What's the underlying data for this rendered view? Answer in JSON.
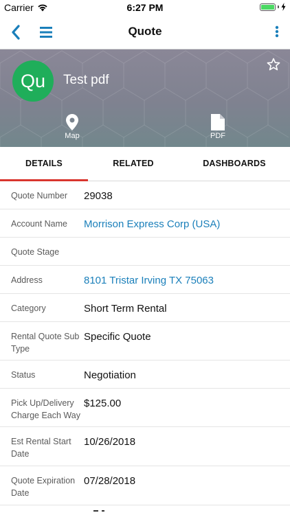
{
  "status_bar": {
    "carrier": "Carrier",
    "time": "6:27 PM"
  },
  "nav": {
    "title": "Quote",
    "accent_color": "#1a7fba"
  },
  "header": {
    "avatar_initials": "Qu",
    "avatar_color": "#1fae5a",
    "record_name": "Test pdf",
    "actions": [
      {
        "label": "Map",
        "icon": "map-pin-icon"
      },
      {
        "label": "PDF",
        "icon": "document-icon"
      }
    ]
  },
  "tabs": {
    "items": [
      {
        "label": "DETAILS",
        "active": true
      },
      {
        "label": "RELATED",
        "active": false
      },
      {
        "label": "DASHBOARDS",
        "active": false
      }
    ],
    "active_color": "#d9352d"
  },
  "fields": [
    {
      "label": "Quote Number",
      "value": "29038",
      "link": false
    },
    {
      "label": "Account Name",
      "value": "Morrison Express Corp (USA)",
      "link": true
    },
    {
      "label": "Quote Stage",
      "value": "",
      "link": false
    },
    {
      "label": "Address",
      "value": "8101 Tristar Irving TX 75063",
      "link": true
    },
    {
      "label": "Category",
      "value": "Short Term Rental",
      "link": false
    },
    {
      "label": "Rental Quote Sub Type",
      "value": "Specific Quote",
      "link": false
    },
    {
      "label": "Status",
      "value": "Negotiation",
      "link": false
    },
    {
      "label": "Pick Up/Delivery Charge Each Way",
      "value": "$125.00",
      "link": false
    },
    {
      "label": "Est Rental Start Date",
      "value": "10/26/2018",
      "link": false
    },
    {
      "label": "Quote Expiration Date",
      "value": "07/28/2018",
      "link": false
    }
  ]
}
